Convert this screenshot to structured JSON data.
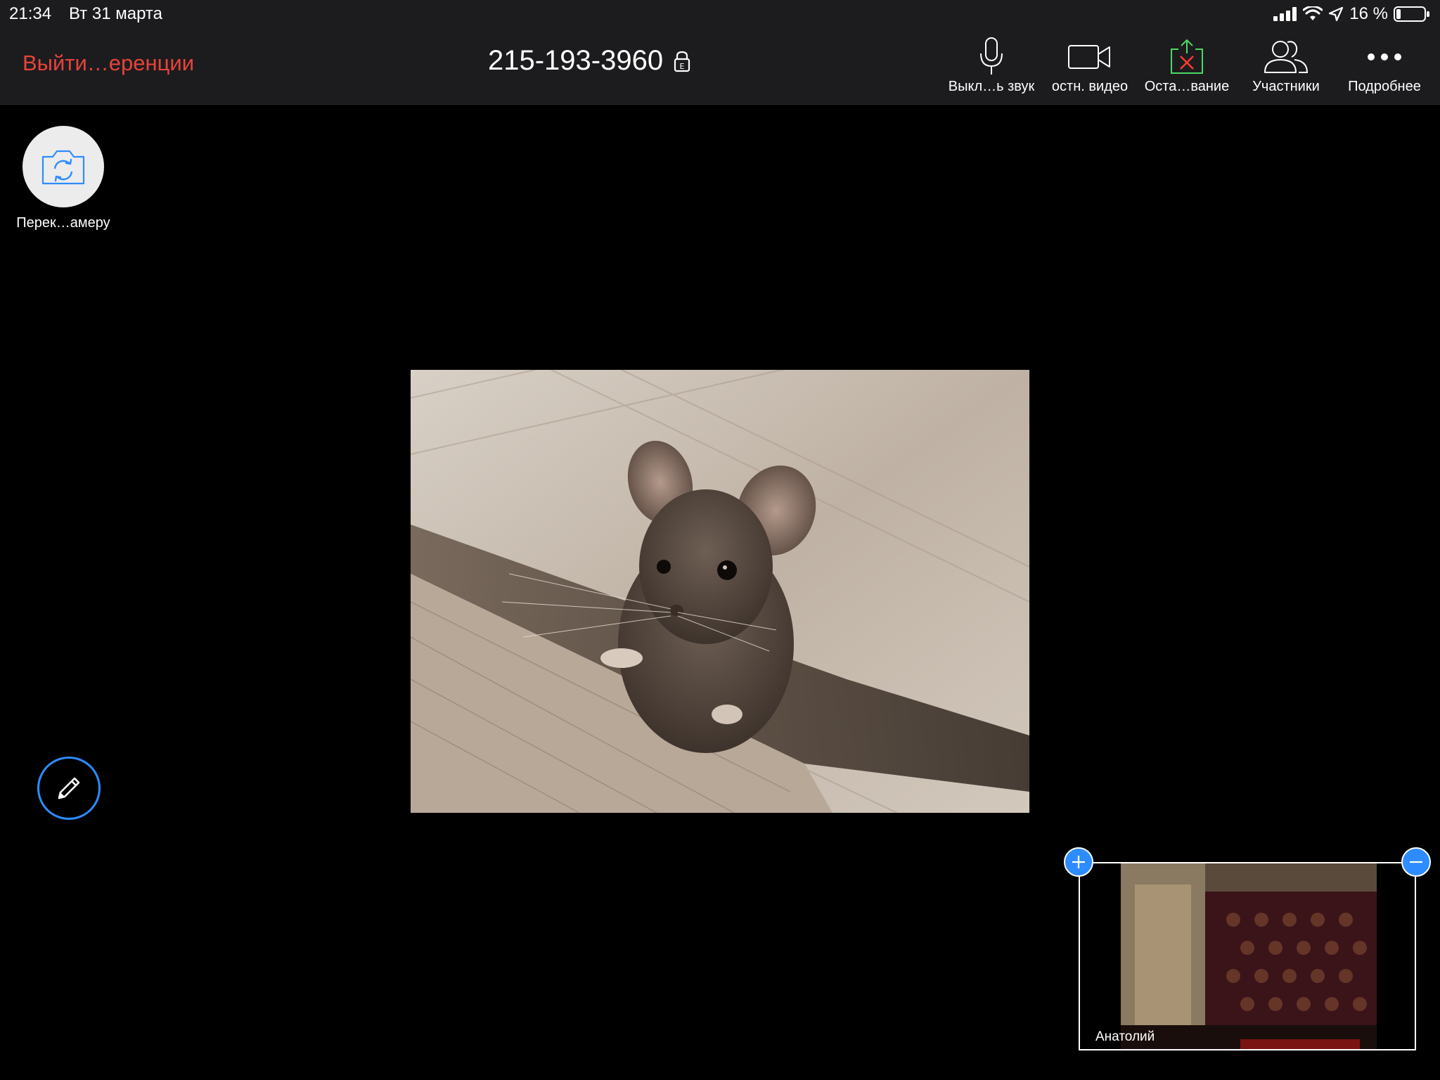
{
  "status_bar": {
    "time": "21:34",
    "date": "Вт 31 марта",
    "battery": "16 %",
    "icons": [
      "cellular-signal-icon",
      "wifi-icon",
      "location-arrow-icon",
      "battery-icon"
    ]
  },
  "toolbar": {
    "leave_label": "Выйти…еренции",
    "meeting_id": "215-193-3960",
    "lock_badge": "E",
    "buttons": [
      {
        "icon": "microphone-icon",
        "label": "Выкл…ь звук"
      },
      {
        "icon": "video-camera-icon",
        "label": "остн. видео"
      },
      {
        "icon": "stop-share-icon",
        "label": "Оста…вание"
      },
      {
        "icon": "participants-icon",
        "label": "Участники"
      },
      {
        "icon": "more-icon",
        "label": "Подробнее"
      }
    ]
  },
  "switch_camera": {
    "label": "Перек…амеру"
  },
  "shared_content": {
    "description_icon": "mouse-photo"
  },
  "thumbnail": {
    "name": "Анатолий"
  },
  "colors": {
    "accent": "#2d8cff",
    "leave": "#e8433a",
    "share_green": "#4cd964",
    "share_red": "#ff3b30",
    "toolbar_bg": "#1c1c1e"
  }
}
